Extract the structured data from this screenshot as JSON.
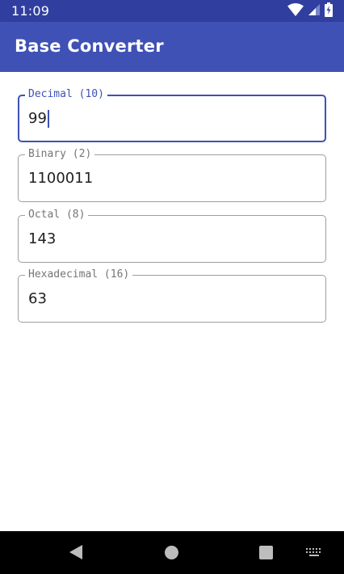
{
  "status_bar": {
    "time": "11:09",
    "icons": [
      "wifi-icon",
      "cellular-signal-icon",
      "battery-charging-icon"
    ]
  },
  "app_bar": {
    "title": "Base Converter"
  },
  "fields": [
    {
      "label": "Decimal (10)",
      "value": "99",
      "focused": true
    },
    {
      "label": "Binary (2)",
      "value": "1100011",
      "focused": false
    },
    {
      "label": "Octal (8)",
      "value": "143",
      "focused": false
    },
    {
      "label": "Hexadecimal (16)",
      "value": "63",
      "focused": false
    }
  ],
  "nav_bar": {
    "icons": [
      "back-icon",
      "home-icon",
      "recents-icon",
      "keyboard-icon"
    ]
  },
  "colors": {
    "status_bar": "#303f9f",
    "app_bar": "#3f51b5",
    "accent": "#3f51b5",
    "field_border": "#9e9e9e"
  }
}
